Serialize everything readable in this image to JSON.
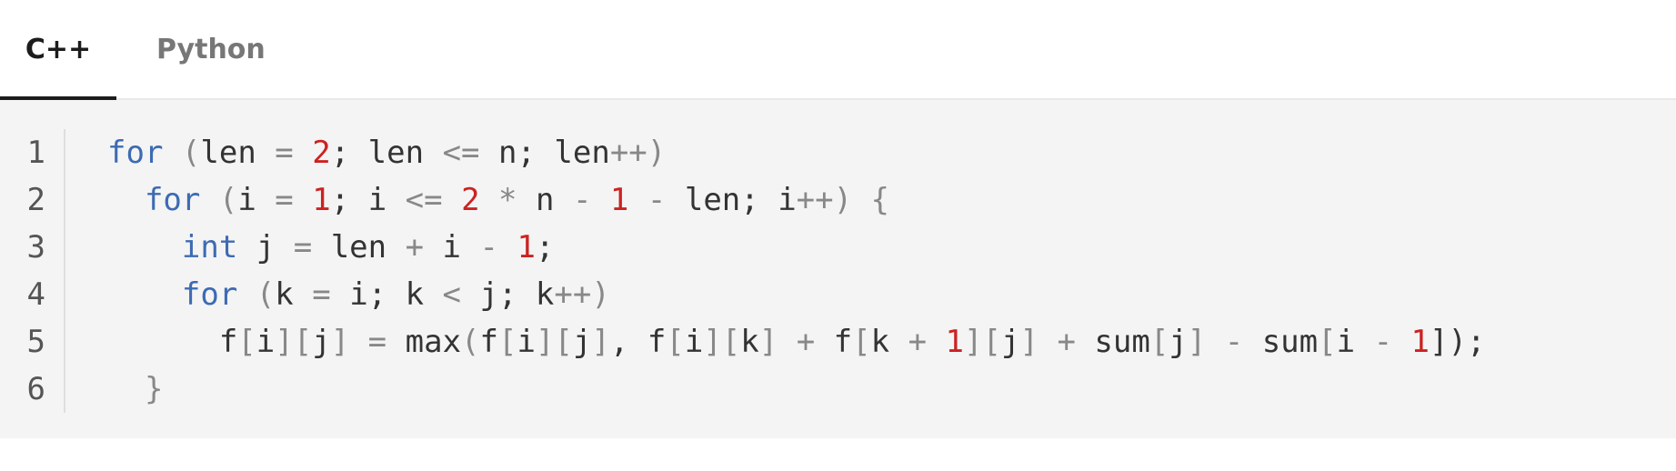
{
  "tabs": [
    {
      "label": "C++",
      "active": true
    },
    {
      "label": "Python",
      "active": false
    }
  ],
  "colors": {
    "keyword": "#3d6bb3",
    "number": "#cc2222",
    "operator": "#888888",
    "text": "#333333",
    "code_background": "#f4f4f4",
    "active_tab_underline": "#1c1c1c"
  },
  "code": {
    "language": "C++",
    "lines": [
      {
        "number": "1",
        "tokens": [
          {
            "t": "for",
            "c": "kw"
          },
          {
            "t": " "
          },
          {
            "t": "(",
            "c": "op"
          },
          {
            "t": "len "
          },
          {
            "t": "=",
            "c": "op"
          },
          {
            "t": " "
          },
          {
            "t": "2",
            "c": "num"
          },
          {
            "t": "; len "
          },
          {
            "t": "<=",
            "c": "op"
          },
          {
            "t": " n; len"
          },
          {
            "t": "++)",
            "c": "op"
          }
        ]
      },
      {
        "number": "2",
        "tokens": [
          {
            "t": "  "
          },
          {
            "t": "for",
            "c": "kw"
          },
          {
            "t": " "
          },
          {
            "t": "(",
            "c": "op"
          },
          {
            "t": "i "
          },
          {
            "t": "=",
            "c": "op"
          },
          {
            "t": " "
          },
          {
            "t": "1",
            "c": "num"
          },
          {
            "t": "; i "
          },
          {
            "t": "<=",
            "c": "op"
          },
          {
            "t": " "
          },
          {
            "t": "2",
            "c": "num"
          },
          {
            "t": " "
          },
          {
            "t": "*",
            "c": "op"
          },
          {
            "t": " n "
          },
          {
            "t": "-",
            "c": "op"
          },
          {
            "t": " "
          },
          {
            "t": "1",
            "c": "num"
          },
          {
            "t": " "
          },
          {
            "t": "-",
            "c": "op"
          },
          {
            "t": " len; i"
          },
          {
            "t": "++) {",
            "c": "op"
          }
        ]
      },
      {
        "number": "3",
        "tokens": [
          {
            "t": "    "
          },
          {
            "t": "int",
            "c": "kw"
          },
          {
            "t": " j "
          },
          {
            "t": "=",
            "c": "op"
          },
          {
            "t": " len "
          },
          {
            "t": "+",
            "c": "op"
          },
          {
            "t": " i "
          },
          {
            "t": "-",
            "c": "op"
          },
          {
            "t": " "
          },
          {
            "t": "1",
            "c": "num"
          },
          {
            "t": ";"
          }
        ]
      },
      {
        "number": "4",
        "tokens": [
          {
            "t": "    "
          },
          {
            "t": "for",
            "c": "kw"
          },
          {
            "t": " "
          },
          {
            "t": "(",
            "c": "op"
          },
          {
            "t": "k "
          },
          {
            "t": "=",
            "c": "op"
          },
          {
            "t": " i; k "
          },
          {
            "t": "<",
            "c": "op"
          },
          {
            "t": " j; k"
          },
          {
            "t": "++)",
            "c": "op"
          }
        ]
      },
      {
        "number": "5",
        "tokens": [
          {
            "t": "      f"
          },
          {
            "t": "[",
            "c": "op"
          },
          {
            "t": "i"
          },
          {
            "t": "][",
            "c": "op"
          },
          {
            "t": "j"
          },
          {
            "t": "]",
            "c": "op"
          },
          {
            "t": " "
          },
          {
            "t": "=",
            "c": "op"
          },
          {
            "t": " max"
          },
          {
            "t": "(",
            "c": "op"
          },
          {
            "t": "f"
          },
          {
            "t": "[",
            "c": "op"
          },
          {
            "t": "i"
          },
          {
            "t": "][",
            "c": "op"
          },
          {
            "t": "j"
          },
          {
            "t": "]",
            "c": "op"
          },
          {
            "t": ", f"
          },
          {
            "t": "[",
            "c": "op"
          },
          {
            "t": "i"
          },
          {
            "t": "][",
            "c": "op"
          },
          {
            "t": "k"
          },
          {
            "t": "]",
            "c": "op"
          },
          {
            "t": " "
          },
          {
            "t": "+",
            "c": "op"
          },
          {
            "t": " f"
          },
          {
            "t": "[",
            "c": "op"
          },
          {
            "t": "k "
          },
          {
            "t": "+",
            "c": "op"
          },
          {
            "t": " "
          },
          {
            "t": "1",
            "c": "num"
          },
          {
            "t": "][",
            "c": "op"
          },
          {
            "t": "j"
          },
          {
            "t": "]",
            "c": "op"
          },
          {
            "t": " "
          },
          {
            "t": "+",
            "c": "op"
          },
          {
            "t": " sum"
          },
          {
            "t": "[",
            "c": "op"
          },
          {
            "t": "j"
          },
          {
            "t": "]",
            "c": "op"
          },
          {
            "t": " "
          },
          {
            "t": "-",
            "c": "op"
          },
          {
            "t": " sum"
          },
          {
            "t": "[",
            "c": "op"
          },
          {
            "t": "i "
          },
          {
            "t": "-",
            "c": "op"
          },
          {
            "t": " "
          },
          {
            "t": "1",
            "c": "num"
          },
          {
            "t": "]);"
          }
        ]
      },
      {
        "number": "6",
        "tokens": [
          {
            "t": "  "
          },
          {
            "t": "}",
            "c": "op"
          }
        ]
      }
    ]
  }
}
